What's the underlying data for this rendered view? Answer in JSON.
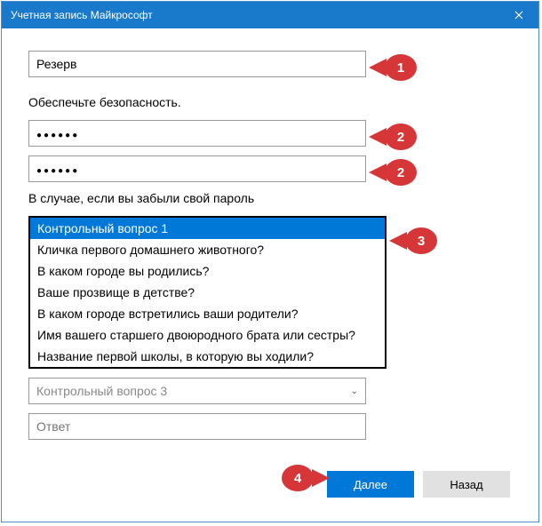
{
  "window": {
    "title": "Учетная запись Майкрософт"
  },
  "username": {
    "value": "Резерв"
  },
  "security_label": "Обеспечьте безопасность.",
  "password": {
    "display": "●●●●●●"
  },
  "password_confirm": {
    "display": "●●●●●●"
  },
  "forgot_label": "В случае, если вы забыли свой пароль",
  "dropdown": {
    "selected": "Контрольный вопрос 1",
    "options": [
      "Кличка первого домашнего животного?",
      "В каком городе вы родились?",
      "Ваше прозвище в детстве?",
      "В каком городе встретились ваши родители?",
      "Имя вашего старшего двоюродного брата или сестры?",
      "Название первой школы, в которую вы ходили?"
    ]
  },
  "question3": {
    "placeholder": "Контрольный вопрос 3"
  },
  "answer": {
    "placeholder": "Ответ"
  },
  "buttons": {
    "next": "Далее",
    "back": "Назад"
  },
  "callouts": {
    "c1": "1",
    "c2": "2",
    "c3": "3",
    "c4": "4"
  }
}
